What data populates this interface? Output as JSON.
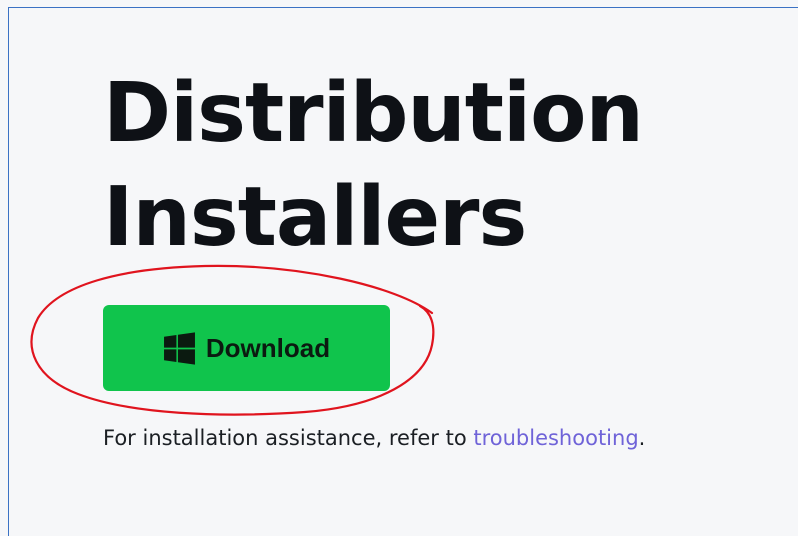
{
  "heading": {
    "line1": "Distribution",
    "line2": "Installers"
  },
  "download": {
    "label": "Download",
    "icon": "windows-icon",
    "color": "#10c44c"
  },
  "note": {
    "prefix": "For installation assistance, refer to ",
    "link_text": "troubleshooting",
    "suffix": "."
  },
  "annotation": {
    "shape": "hand-drawn-circle",
    "color": "#e0141e"
  }
}
